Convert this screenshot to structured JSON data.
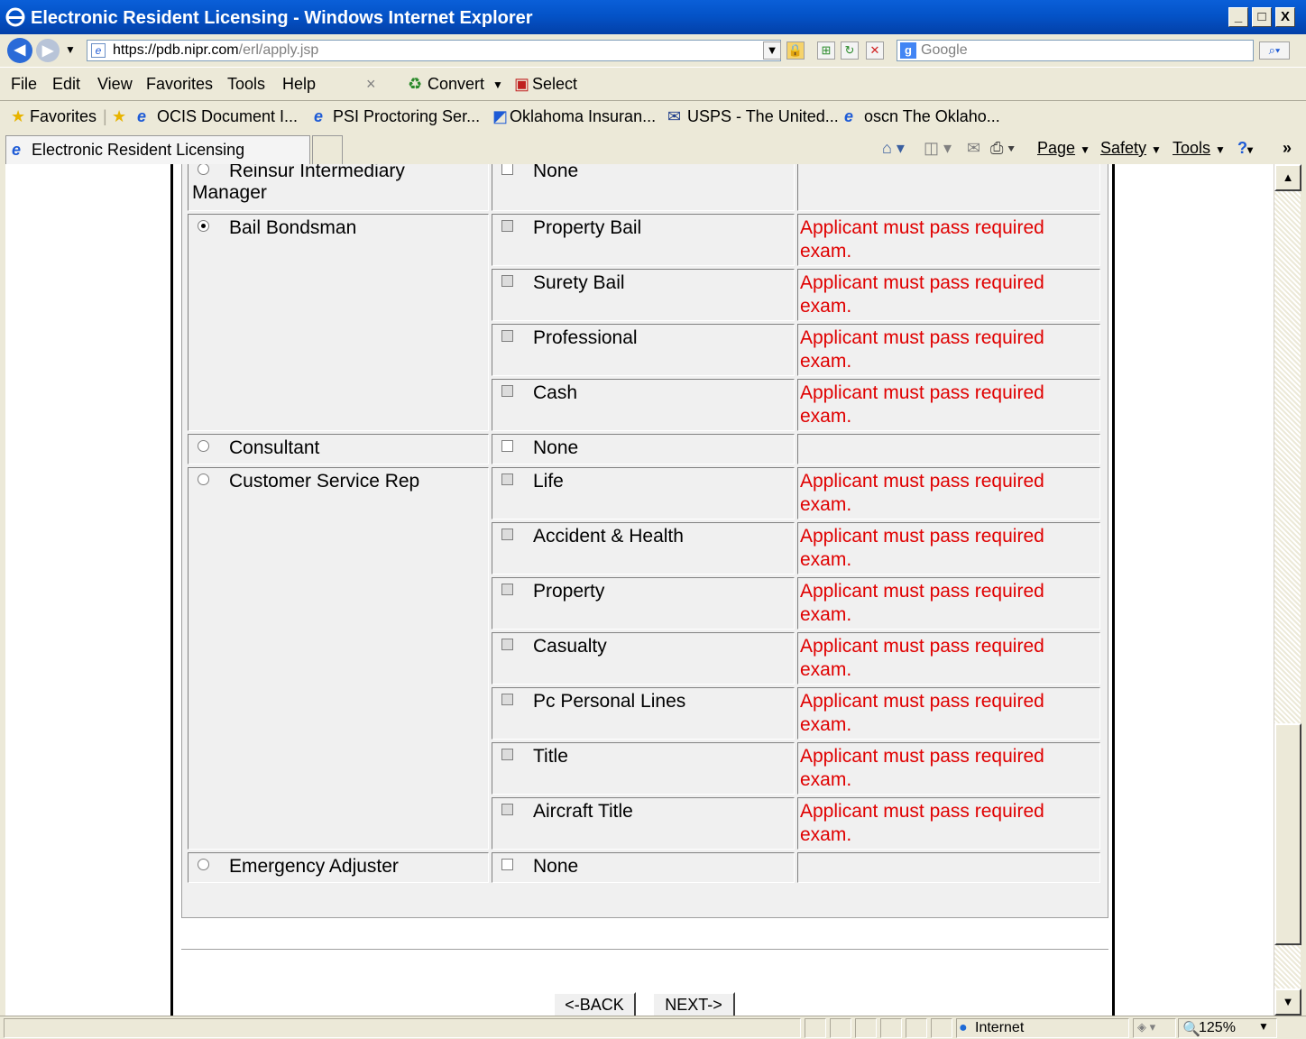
{
  "window": {
    "title": "Electronic Resident Licensing - Windows Internet Explorer",
    "minimize": "_",
    "maximize": "□",
    "close": "X"
  },
  "address": {
    "url_host": "https://pdb.nipr.com",
    "url_path": "/erl/apply.jsp",
    "search_placeholder": "Google"
  },
  "menu": {
    "items": [
      "File",
      "Edit",
      "View",
      "Favorites",
      "Tools",
      "Help"
    ],
    "close_x": "×",
    "convert": "Convert",
    "select": "Select"
  },
  "favorites": {
    "label": "Favorites",
    "items": [
      "OCIS Document I...",
      "PSI Proctoring Ser...",
      "Oklahoma Insuran...",
      "USPS - The United...",
      "oscn The Oklaho..."
    ]
  },
  "tabs": {
    "active": "Electronic Resident Licensing"
  },
  "command_bar": {
    "page": "Page",
    "safety": "Safety",
    "tools": "Tools",
    "help": "?",
    "more": "»"
  },
  "license_rows": [
    {
      "license": "Reinsur Intermediary Manager",
      "selected": false,
      "lines": [
        {
          "name": "None",
          "message": ""
        }
      ]
    },
    {
      "license": "Bail Bondsman",
      "selected": true,
      "lines": [
        {
          "name": "Property Bail",
          "message": "Applicant must pass required exam."
        },
        {
          "name": "Surety Bail",
          "message": "Applicant must pass required exam."
        },
        {
          "name": "Professional",
          "message": "Applicant must pass required exam."
        },
        {
          "name": "Cash",
          "message": "Applicant must pass required exam."
        }
      ]
    },
    {
      "license": "Consultant",
      "selected": false,
      "lines": [
        {
          "name": "None",
          "message": ""
        }
      ]
    },
    {
      "license": "Customer Service Rep",
      "selected": false,
      "lines": [
        {
          "name": "Life",
          "message": "Applicant must pass required exam."
        },
        {
          "name": "Accident & Health",
          "message": "Applicant must pass required exam."
        },
        {
          "name": "Property",
          "message": "Applicant must pass required exam."
        },
        {
          "name": "Casualty",
          "message": "Applicant must pass required exam."
        },
        {
          "name": "Pc Personal Lines",
          "message": "Applicant must pass required exam."
        },
        {
          "name": "Title",
          "message": "Applicant must pass required exam."
        },
        {
          "name": "Aircraft Title",
          "message": "Applicant must pass required exam."
        }
      ]
    },
    {
      "license": "Emergency Adjuster",
      "selected": false,
      "lines": [
        {
          "name": "None",
          "message": ""
        }
      ]
    }
  ],
  "buttons": {
    "back": "<-BACK",
    "next": "NEXT->"
  },
  "status": {
    "zone": "Internet",
    "zoom": "125%"
  },
  "colors": {
    "error": "#e00000",
    "titlebar": "#0453c8"
  }
}
